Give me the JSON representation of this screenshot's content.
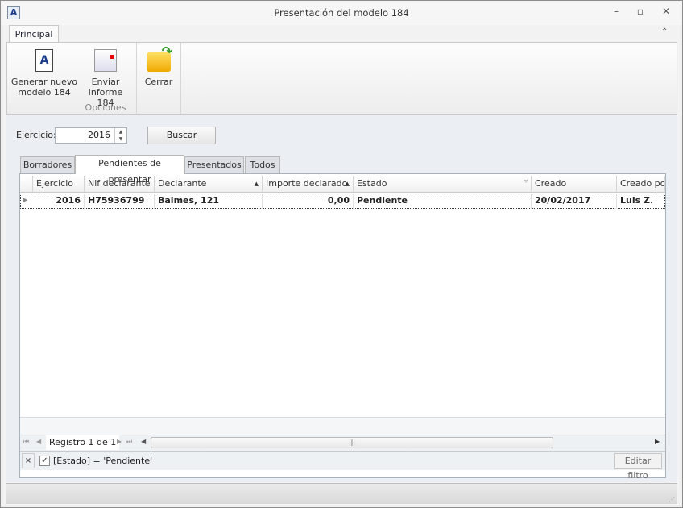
{
  "window": {
    "title": "Presentación del modelo 184"
  },
  "ribbon": {
    "tab": "Principal",
    "buttons": [
      {
        "label_line1": "Generar nuevo",
        "label_line2": "modelo 184"
      },
      {
        "label_line1": "Enviar",
        "label_line2": "informe 184"
      },
      {
        "label_line1": "Cerrar",
        "label_line2": ""
      }
    ],
    "group_label": "Opciones"
  },
  "filter": {
    "ejercicio_label": "Ejercicio:",
    "ejercicio_value": "2016",
    "search_label": "Buscar"
  },
  "tabs": [
    "Borradores",
    "Pendientes de presentar",
    "Presentados",
    "Todos"
  ],
  "grid": {
    "columns": [
      "Ejercicio",
      "Nif declarante",
      "Declarante",
      "Importe declarado",
      "Estado",
      "Creado",
      "Creado por"
    ],
    "rows": [
      [
        "2016",
        "H75936799",
        "Balmes, 121",
        "0,00",
        "Pendiente",
        "20/02/2017",
        "Luis Z."
      ]
    ],
    "nav_text": "Registro 1 de 1",
    "filter_text": "[Estado] = 'Pendiente'",
    "filter_checked": true,
    "edit_filter_label": "Editar filtro"
  }
}
